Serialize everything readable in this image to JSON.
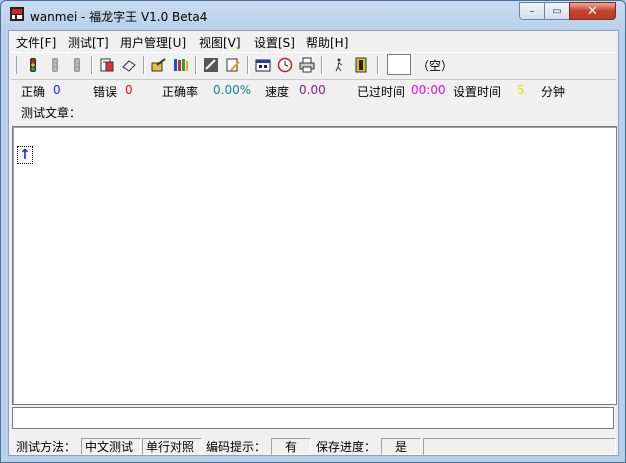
{
  "window": {
    "title": "wanmei - 福龙字王 V1.0 Beta4",
    "buttons": {
      "minimize": "–",
      "maximize": "▭",
      "close": "✕"
    }
  },
  "menu": [
    {
      "label": "文件[F]"
    },
    {
      "label": "测试[T]"
    },
    {
      "label": "用户管理[U]"
    },
    {
      "label": "视图[V]"
    },
    {
      "label": "设置[S]"
    },
    {
      "label": "帮助[H]"
    }
  ],
  "toolbar": {
    "icons": [
      "start-icon",
      "pause-icon",
      "stop-icon",
      "article-icon",
      "eraser-icon",
      "import-icon",
      "library-icon",
      "mode-icon",
      "edit-icon",
      "calendar-icon",
      "clock-icon",
      "print-icon",
      "walker-icon",
      "exit-icon"
    ],
    "ime_label": "（空）"
  },
  "stats": {
    "correct_label": "正确",
    "correct_value": "0",
    "errors_label": "错误",
    "errors_value": "0",
    "accuracy_label": "正确率",
    "accuracy_value": "0.00%",
    "speed_label": "速度",
    "speed_value": "0.00",
    "elapsed_label": "已过时间",
    "elapsed_value": "00:00",
    "set_time_label": "设置时间",
    "set_time_value": "5",
    "minutes_label": "分钟",
    "colors": {
      "correct": "#1a2ccf",
      "errors": "#e01010",
      "accuracy": "#108a8a",
      "speed": "#8a1a8a",
      "elapsed": "#e010e0",
      "set_time": "#e0e000"
    }
  },
  "article_label": "测试文章：",
  "statusbar": {
    "method_label": "测试方法：",
    "method_value": "中文测试",
    "mode_value": "单行对照",
    "hint_label": "编码提示：",
    "hint_value": "有",
    "save_label": "保存进度：",
    "save_value": "是"
  }
}
